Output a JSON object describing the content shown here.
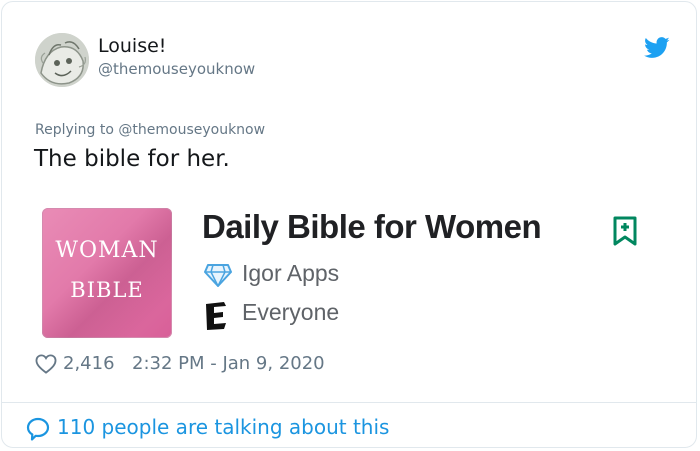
{
  "author": {
    "display_name": "Louise!",
    "handle": "@themouseyouknow"
  },
  "reply": {
    "prefix": "Replying to",
    "handle": "@themouseyouknow"
  },
  "tweet": {
    "text": "The bible for her."
  },
  "app_card": {
    "icon_word_1": "Woman",
    "icon_word_2": "Bible",
    "title": "Daily Bible for Women",
    "developer": "Igor Apps",
    "content_rating": "Everyone",
    "rating_badge_letter": "E"
  },
  "meta": {
    "likes": "2,416",
    "timestamp": "2:32 PM - Jan 9, 2020"
  },
  "footer": {
    "talking": "110 people are talking about this"
  },
  "icons": {
    "logo": "twitter-bird-icon",
    "bookmark": "bookmark-add-icon",
    "developer": "developer-badge-icon",
    "rating": "esrb-e-icon",
    "like": "heart-icon",
    "reply": "speech-bubble-icon"
  },
  "colors": {
    "twitter_blue": "#1da1f2",
    "link_blue": "#1b95e0",
    "muted_gray": "#657786",
    "play_green": "#01875f",
    "icon_pink": "#e28ab4"
  }
}
